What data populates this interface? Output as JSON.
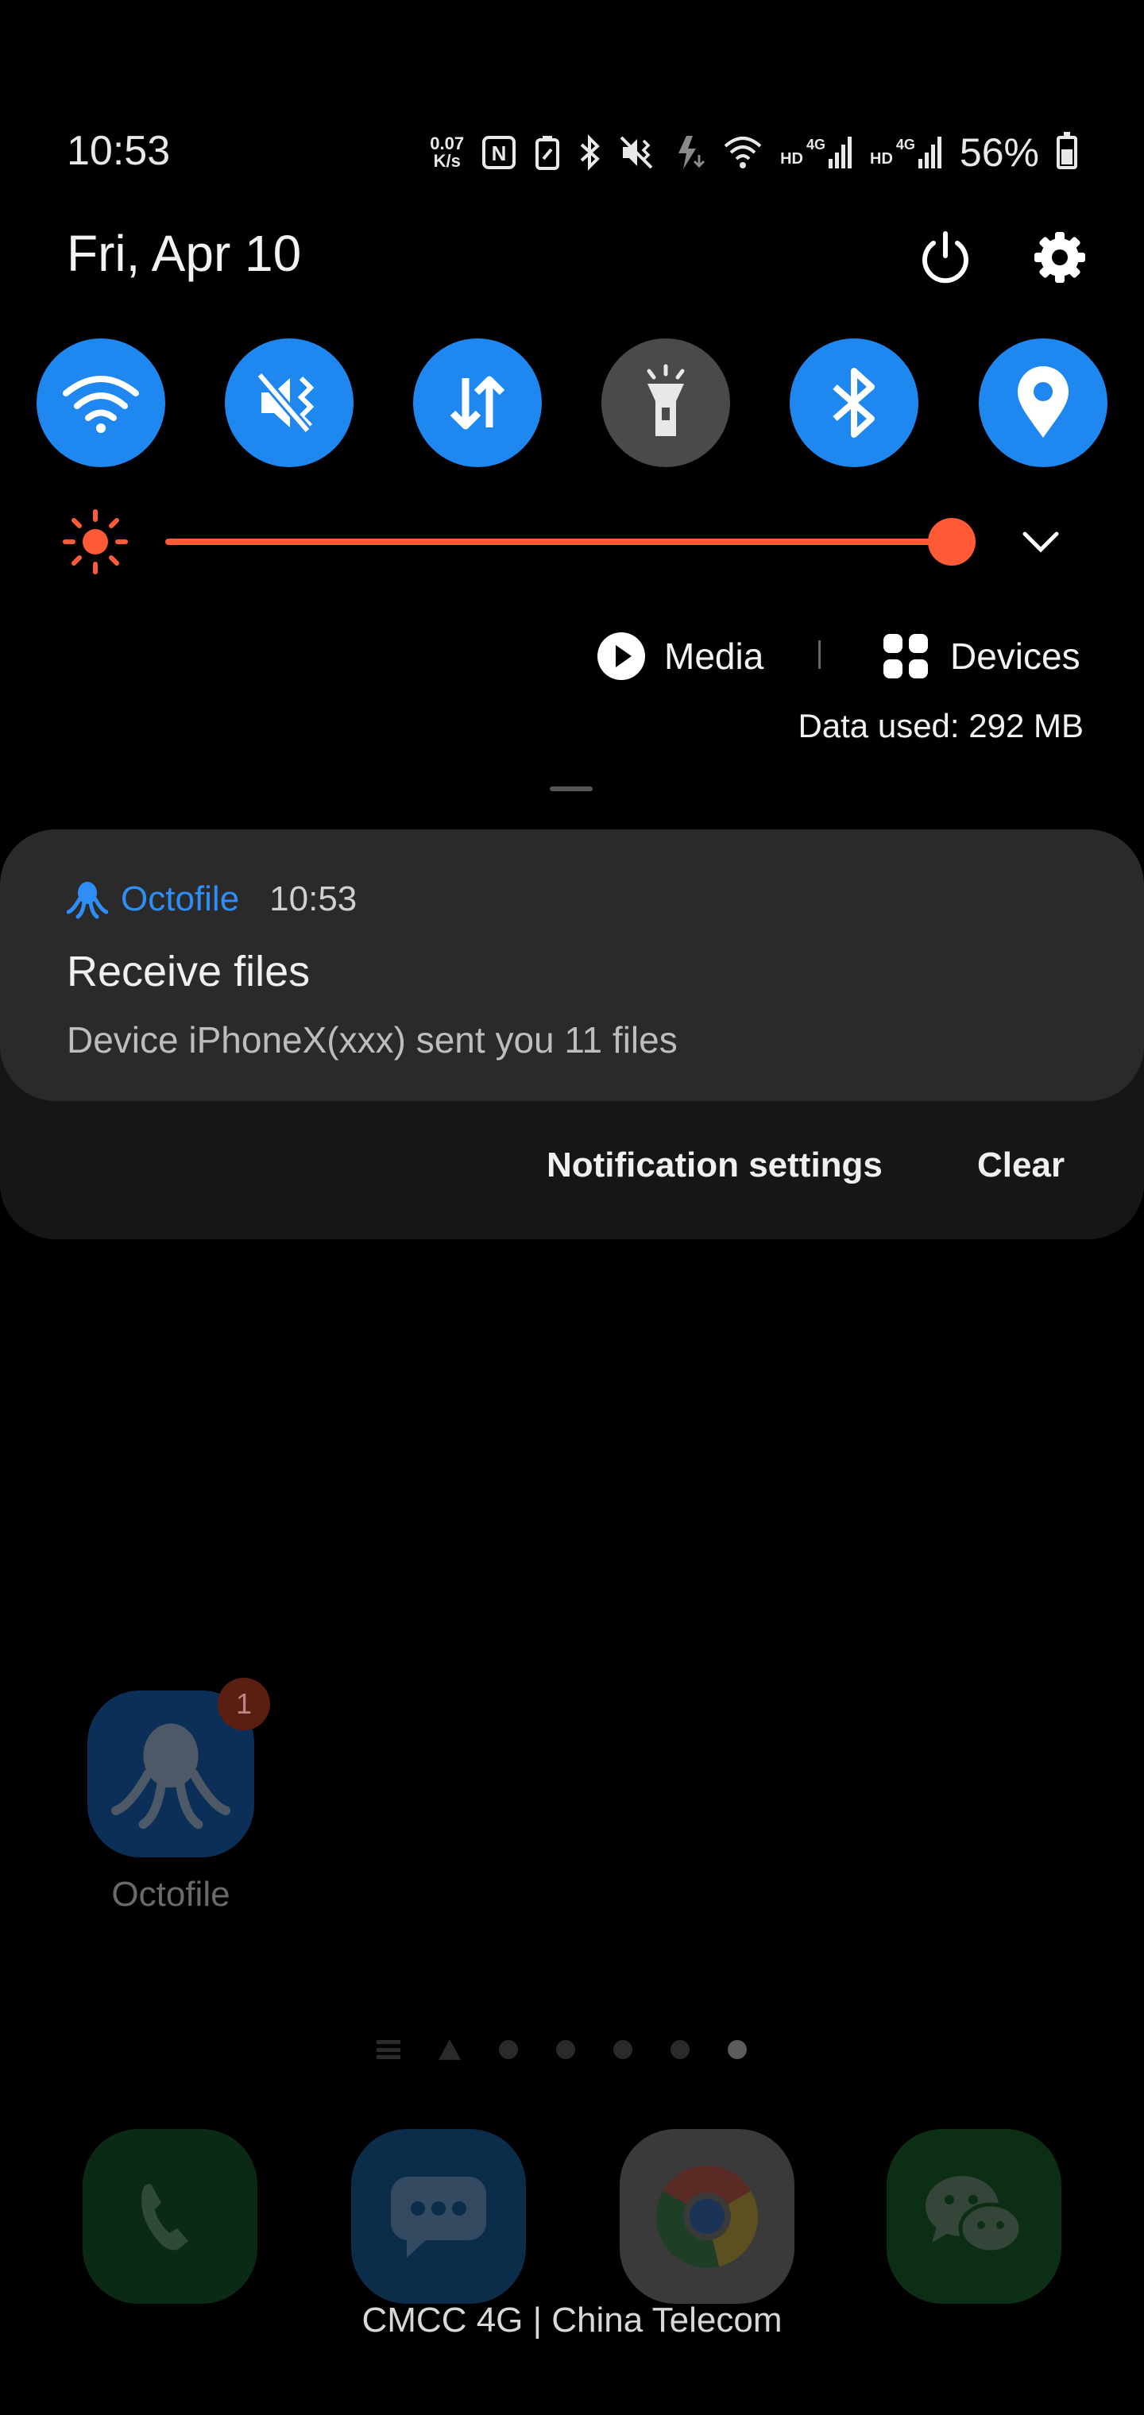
{
  "status_bar": {
    "time": "10:53",
    "net_speed_value": "0.07",
    "net_speed_unit": "K/s",
    "nfc": "N",
    "network_1_tag": "HD",
    "network_1_type": "4G",
    "network_2_tag": "HD",
    "network_2_type": "4G",
    "battery_percent": "56%"
  },
  "header": {
    "date": "Fri, Apr 10"
  },
  "quick_toggles": [
    {
      "name": "wifi",
      "icon": "wifi-icon",
      "state": "on"
    },
    {
      "name": "sound",
      "icon": "mute-vibrate-icon",
      "state": "on"
    },
    {
      "name": "mobile-data",
      "icon": "data-arrows-icon",
      "state": "on"
    },
    {
      "name": "flashlight",
      "icon": "flashlight-icon",
      "state": "off"
    },
    {
      "name": "bluetooth",
      "icon": "bluetooth-icon",
      "state": "on"
    },
    {
      "name": "location",
      "icon": "location-pin-icon",
      "state": "on"
    }
  ],
  "brightness": {
    "level": 1.0,
    "color": "#ff5a36"
  },
  "media_row": {
    "media_label": "Media",
    "devices_label": "Devices",
    "data_used": "Data used: 292 MB"
  },
  "notification": {
    "app_name": "Octofile",
    "time": "10:53",
    "title": "Receive files",
    "body": "Device iPhoneX(xxx) sent you 11 files",
    "settings_label": "Notification settings",
    "clear_label": "Clear",
    "app_color": "#2f8ef5"
  },
  "home_screen": {
    "app_label": "Octofile",
    "badge_count": "1",
    "page_count": 5,
    "active_page": 5
  },
  "dock": [
    {
      "name": "phone",
      "icon": "phone-icon"
    },
    {
      "name": "messages",
      "icon": "message-icon"
    },
    {
      "name": "chrome",
      "icon": "chrome-icon"
    },
    {
      "name": "wechat",
      "icon": "wechat-icon"
    }
  ],
  "carrier_text": "CMCC 4G | China Telecom",
  "colors": {
    "accent": "#1e88f0",
    "background": "#000000",
    "card": "#2a2a2a"
  }
}
